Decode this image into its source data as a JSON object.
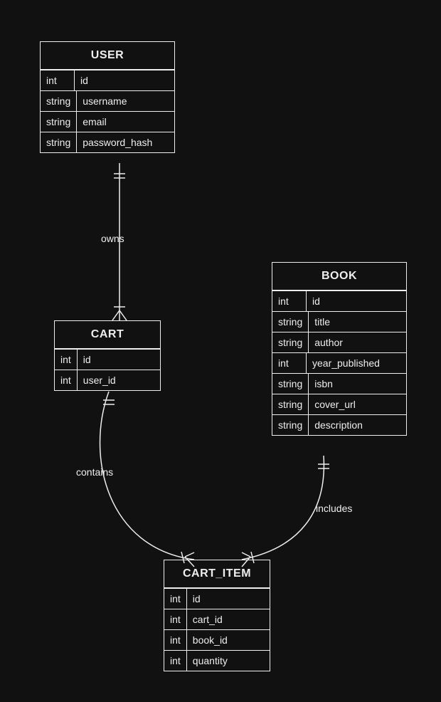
{
  "entities": {
    "user": {
      "title": "USER",
      "attrs": [
        {
          "type": "int",
          "name": "id"
        },
        {
          "type": "string",
          "name": "username"
        },
        {
          "type": "string",
          "name": "email"
        },
        {
          "type": "string",
          "name": "password_hash"
        }
      ]
    },
    "cart": {
      "title": "CART",
      "attrs": [
        {
          "type": "int",
          "name": "id"
        },
        {
          "type": "int",
          "name": "user_id"
        }
      ]
    },
    "book": {
      "title": "BOOK",
      "attrs": [
        {
          "type": "int",
          "name": "id"
        },
        {
          "type": "string",
          "name": "title"
        },
        {
          "type": "string",
          "name": "author"
        },
        {
          "type": "int",
          "name": "year_published"
        },
        {
          "type": "string",
          "name": "isbn"
        },
        {
          "type": "string",
          "name": "cover_url"
        },
        {
          "type": "string",
          "name": "description"
        }
      ]
    },
    "cart_item": {
      "title": "CART_ITEM",
      "attrs": [
        {
          "type": "int",
          "name": "id"
        },
        {
          "type": "int",
          "name": "cart_id"
        },
        {
          "type": "int",
          "name": "book_id"
        },
        {
          "type": "int",
          "name": "quantity"
        }
      ]
    }
  },
  "relationships": {
    "owns": "owns",
    "contains": "contains",
    "includes": "includes"
  }
}
